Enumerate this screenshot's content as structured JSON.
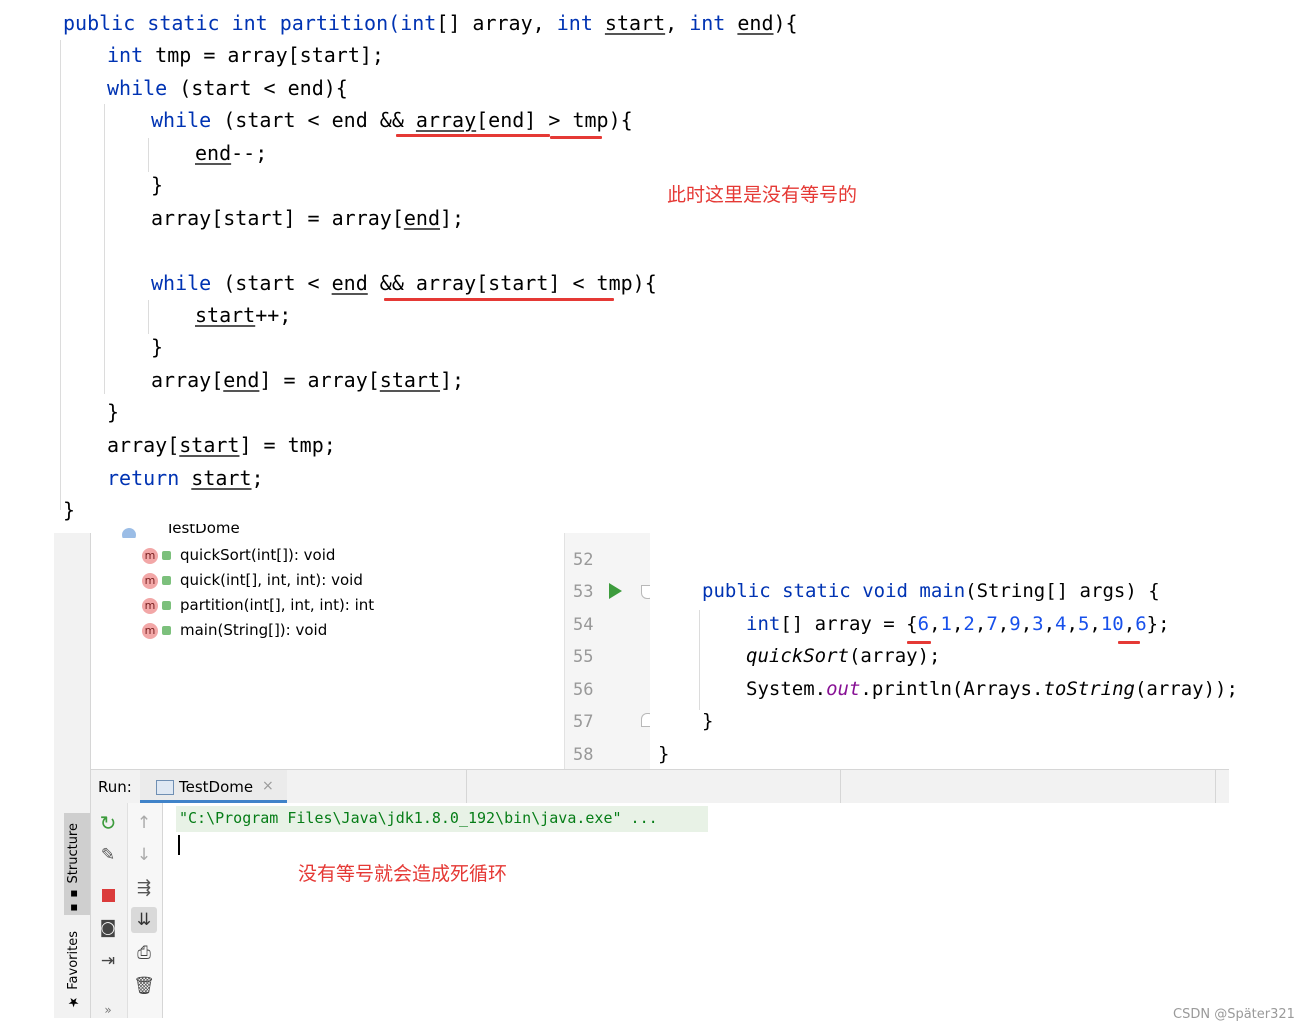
{
  "top_code": {
    "l1": {
      "kw_public": "public",
      "kw_static": "static",
      "kw_int": "int",
      "name": "partition(",
      "kw_int2": "int",
      "rest1": "[] array, ",
      "kw_int3": "int",
      "start": "start",
      "comma": ", ",
      "kw_int4": "int",
      "end": "end",
      "close": "){"
    },
    "l2": {
      "kw": "int",
      "rest": " tmp = array[start];"
    },
    "l3": {
      "kw": "while",
      "rest": " (start < end){"
    },
    "l4": {
      "kw": "while",
      "rest": " (start < end && ",
      "u": "array",
      "rest2": "[end] > tmp){"
    },
    "l5": {
      "u": "end",
      "rest": "--;"
    },
    "l6": "}",
    "l7": {
      "a": "array[start] = array[",
      "u": "end",
      "b": "];"
    },
    "l8": {
      "kw": "while",
      "a": " (start < ",
      "u": "end",
      "b": " && array[start] < tmp){"
    },
    "l9": {
      "u": "start",
      "rest": "++;"
    },
    "l10": "}",
    "l11": {
      "a": "array[",
      "u1": "end",
      "b": "] = array[",
      "u2": "start",
      "c": "];"
    },
    "l12": "}",
    "l13": {
      "a": "array[",
      "u": "start",
      "b": "] = tmp;"
    },
    "l14": {
      "kw": "return",
      "sp": " ",
      "u": "start",
      "b": ";"
    },
    "l15": "}"
  },
  "annotations": {
    "note1": "此时这里是没有等号的",
    "note2": "没有等号就会造成死循环"
  },
  "structure": {
    "header_partial": "TestDome",
    "items": [
      {
        "icon": "m",
        "label": "quickSort(int[]): void"
      },
      {
        "icon": "m",
        "label": "quick(int[], int, int): void"
      },
      {
        "icon": "m",
        "label": "partition(int[], int, int): int"
      },
      {
        "icon": "m",
        "label": "main(String[]): void"
      }
    ]
  },
  "side_tabs": {
    "structure": "Structure",
    "favorites": "Favorites",
    "more": "»"
  },
  "editor": {
    "line_numbers": [
      "52",
      "53",
      "54",
      "55",
      "56",
      "57",
      "58"
    ],
    "l53": {
      "kw_public": "public",
      "kw_static": "static",
      "kw_void": "void",
      "name": "main",
      "rest": "(String[] args) {"
    },
    "l54": {
      "kw": "int",
      "a": "[] array = {",
      "n1": "6",
      "c1": ",",
      "n2": "1",
      "c2": ",",
      "n3": "2",
      "c3": ",",
      "n4": "7",
      "c4": ",",
      "n5": "9",
      "c5": ",",
      "n6": "3",
      "c6": ",",
      "n7": "4",
      "c7": ",",
      "n8": "5",
      "c8": ",",
      "n9": "10",
      "c9": ",",
      "n10": "6",
      "end": "};"
    },
    "l55": {
      "m": "quickSort",
      "rest": "(array);"
    },
    "l56": {
      "a": "System.",
      "f": "out",
      "b": ".println(Arrays.",
      "m": "toString",
      "c": "(array));"
    },
    "l57": "}",
    "l58": "}"
  },
  "run_panel": {
    "label": "Run:",
    "tab": "TestDome",
    "close": "×",
    "command": "\"C:\\Program Files\\Java\\jdk1.8.0_192\\bin\\java.exe\" ..."
  },
  "colors": {
    "keyword": "#0033b3",
    "number": "#1750eb",
    "annotation_red": "#e53935",
    "static_field": "#871094",
    "console_green": "#067d17"
  },
  "watermark": "CSDN @Später321"
}
